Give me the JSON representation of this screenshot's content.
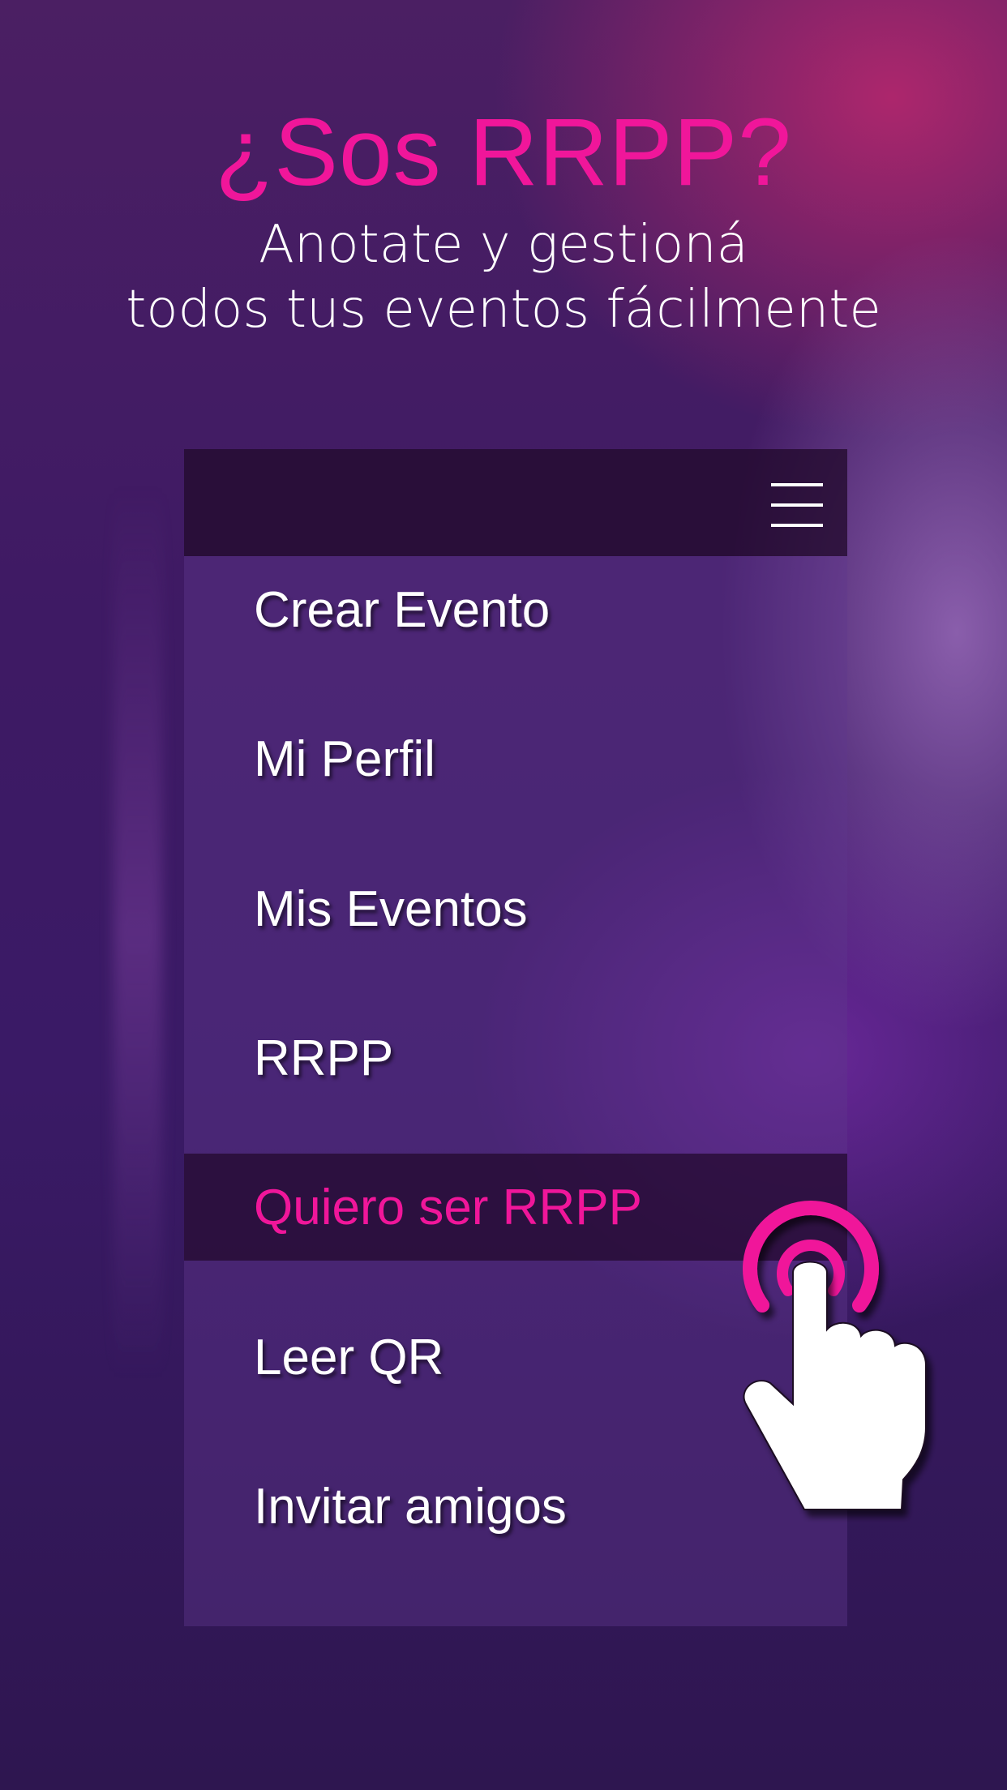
{
  "header": {
    "title": "¿Sos RRPP?",
    "subtitle_line1": "Anotate y gestioná",
    "subtitle_line2": "todos tus eventos fácilmente"
  },
  "menu": {
    "items": [
      {
        "label": "Crear Evento"
      },
      {
        "label": "Mi Perfil"
      },
      {
        "label": "Mis Eventos"
      },
      {
        "label": "RRPP"
      },
      {
        "label": "Quiero ser RRPP",
        "active": true
      },
      {
        "label": "Leer QR"
      },
      {
        "label": "Invitar amigos"
      }
    ]
  },
  "icons": {
    "menu": "hamburger-menu-icon",
    "pointer": "tap-hand-icon"
  },
  "colors": {
    "accent": "#f0169a",
    "text": "#ffffff",
    "header_bar": "#230a2d"
  }
}
